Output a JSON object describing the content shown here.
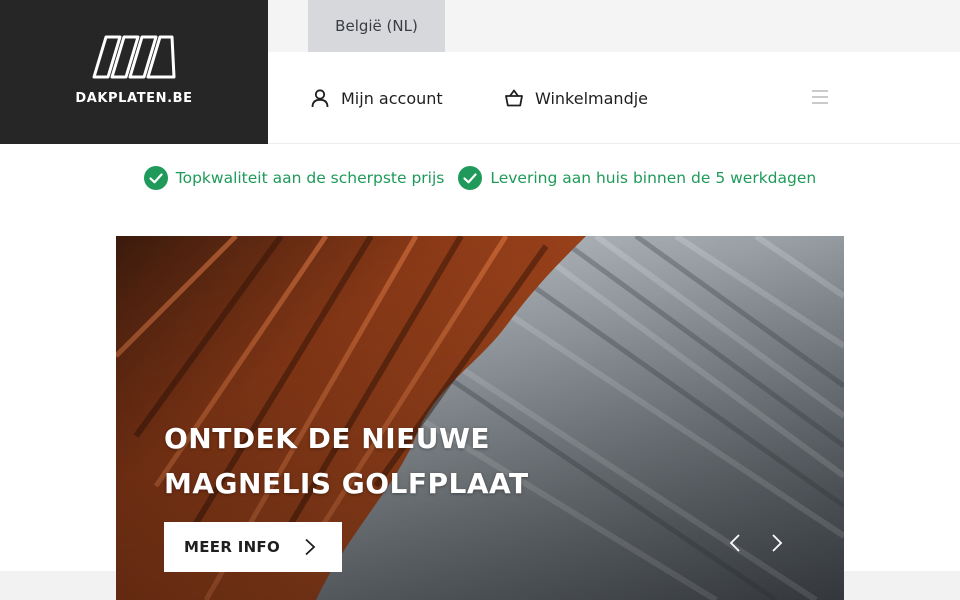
{
  "brand": {
    "name": "DAKPLATEN.BE"
  },
  "header": {
    "language": "België (NL)",
    "account_label": "Mijn account",
    "cart_label": "Winkelmandje"
  },
  "usps": [
    {
      "text": "Topkwaliteit aan de scherpste prijs",
      "icon": "check-circle-icon"
    },
    {
      "text": "Levering aan huis binnen de 5 werkdagen",
      "icon": "check-circle-icon"
    }
  ],
  "hero": {
    "title_line1": "ONTDEK DE NIEUWE",
    "title_line2": "MAGNELIS GOLFPLAAT",
    "cta_label": "MEER INFO"
  },
  "colors": {
    "logo_bg": "#262626",
    "accent_green": "#1f9a5a",
    "lang_bg": "#d6d8dc",
    "top_strip_bg": "#f4f4f4"
  },
  "icons": {
    "account": "user-icon",
    "cart": "basket-icon",
    "menu": "hamburger-icon",
    "cta": "chevron-right-icon",
    "prev": "chevron-left-icon",
    "next": "chevron-right-icon"
  }
}
